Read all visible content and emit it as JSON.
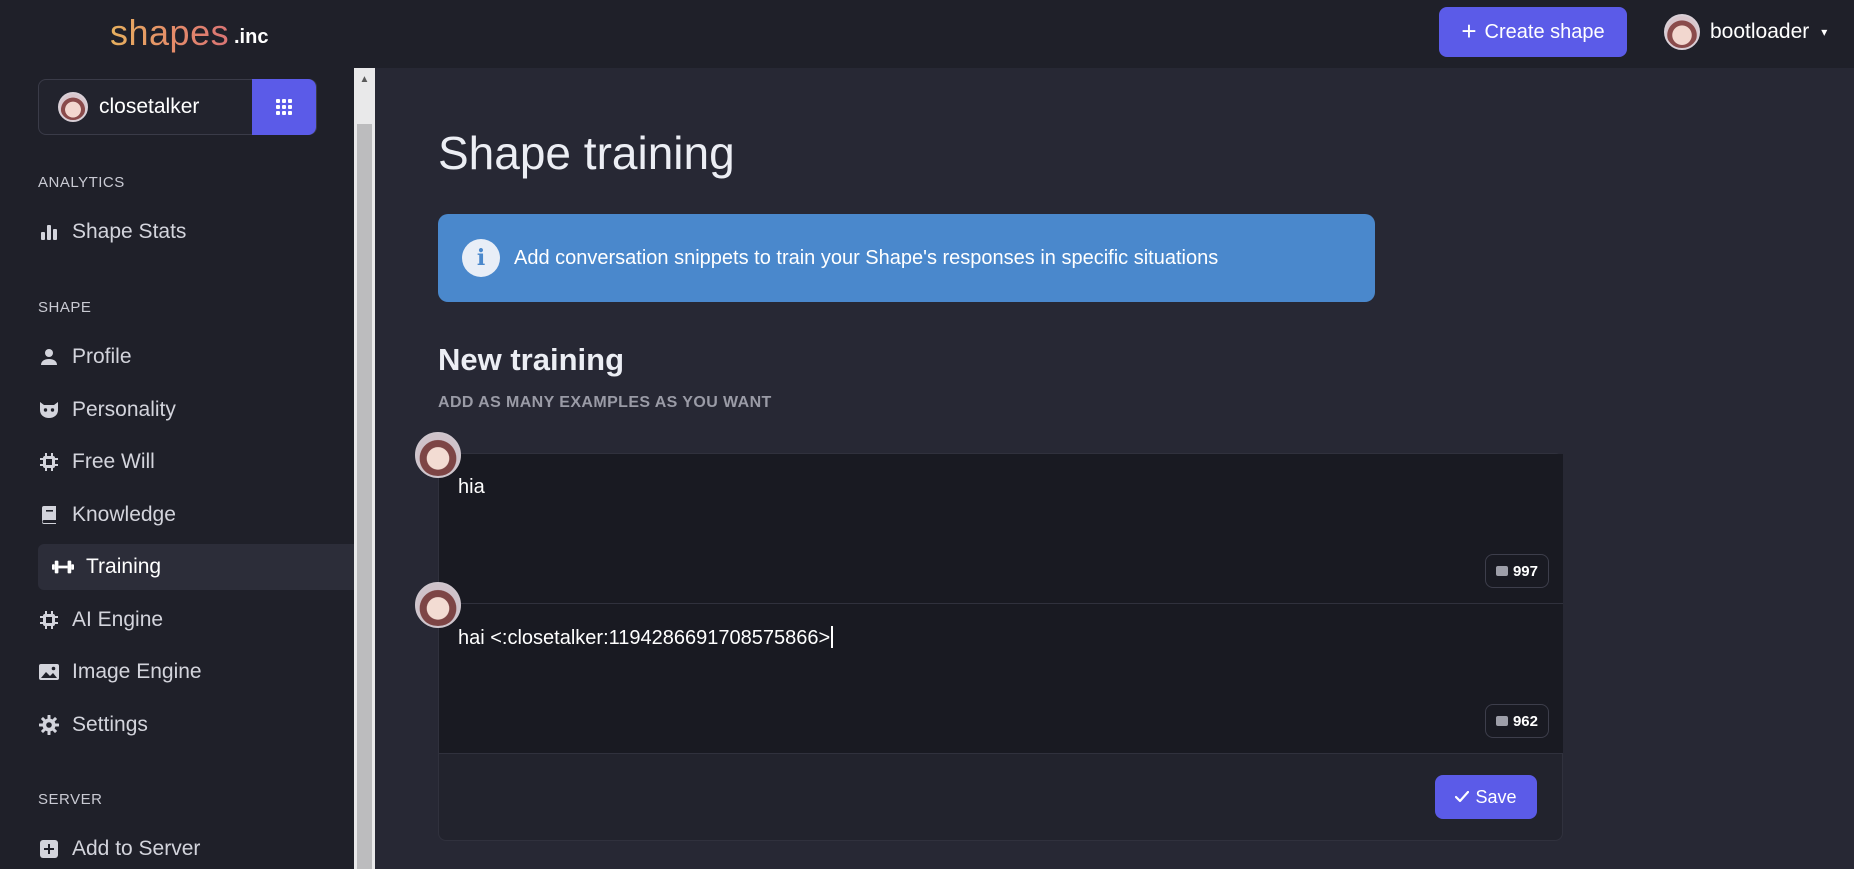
{
  "header": {
    "logo_main": "shapes",
    "logo_suffix": ".inc",
    "create_button": "Create shape",
    "create_icon": "+",
    "username": "bootloader",
    "caret": "▾"
  },
  "sidebar": {
    "selected_shape": "closetalker",
    "sections": {
      "analytics": "ANALYTICS",
      "shape": "SHAPE",
      "server": "SERVER"
    },
    "items": [
      {
        "label": "Shape Stats",
        "icon": "bar-chart-icon"
      },
      {
        "label": "Profile",
        "icon": "user-icon"
      },
      {
        "label": "Personality",
        "icon": "mask-icon"
      },
      {
        "label": "Free Will",
        "icon": "chip-icon"
      },
      {
        "label": "Knowledge",
        "icon": "book-icon"
      },
      {
        "label": "Training",
        "icon": "dumbbell-icon",
        "active": true
      },
      {
        "label": "AI Engine",
        "icon": "chip-icon"
      },
      {
        "label": "Image Engine",
        "icon": "image-icon"
      },
      {
        "label": "Settings",
        "icon": "gear-icon"
      },
      {
        "label": "Add to Server",
        "icon": "plus-square-icon"
      }
    ]
  },
  "main": {
    "title": "Shape training",
    "info_text": "Add conversation snippets to train your Shape's responses in specific situations",
    "info_icon": "i",
    "section_title": "New training",
    "section_subtitle": "ADD AS MANY EXAMPLES AS YOU WANT",
    "messages": [
      {
        "text": "hia",
        "remaining": "997"
      },
      {
        "text": "hai <:closetalker:1194286691708575866>",
        "remaining": "962"
      }
    ],
    "save_button": "Save"
  },
  "colors": {
    "accent": "#5b5be8",
    "info": "#4a88cc",
    "background": "#272834",
    "sidebar": "#1f2029"
  }
}
